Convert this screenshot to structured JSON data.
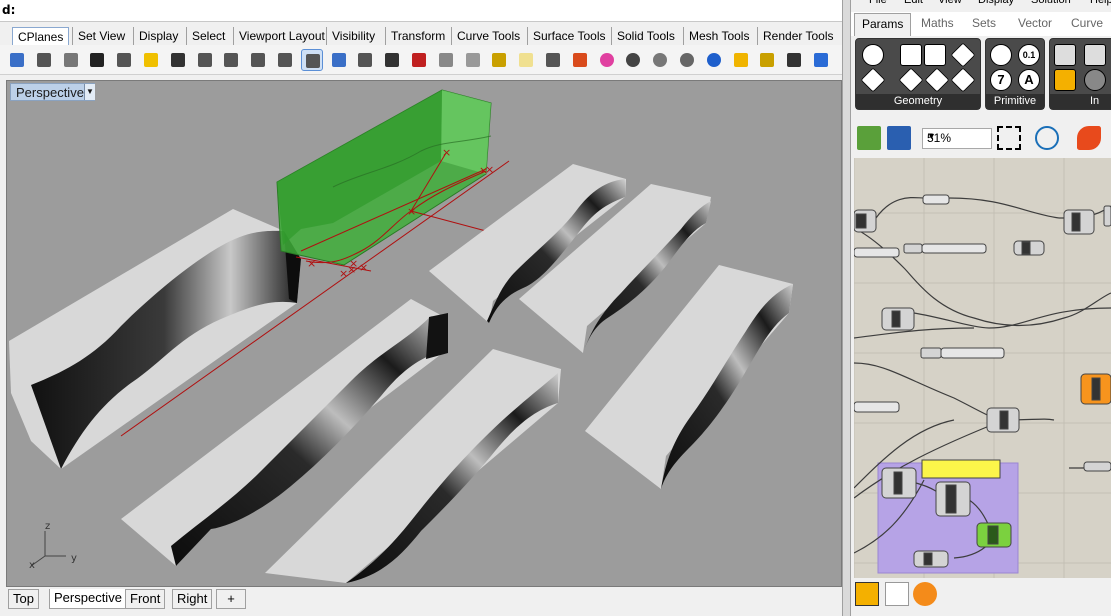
{
  "command": {
    "prompt": "d:"
  },
  "rhino_tabs": [
    "CPlanes",
    "Set View",
    "Display",
    "Select",
    "Viewport Layout",
    "Visibility",
    "Transform",
    "Curve Tools",
    "Surface Tools",
    "Solid Tools",
    "Mesh Tools",
    "Render Tools"
  ],
  "toolbar_icons": [
    "save-icon",
    "print-icon",
    "import-icon",
    "cut-icon",
    "copy-icon",
    "paste-icon",
    "undo-icon",
    "pan-hand-icon",
    "move-view-icon",
    "zoom-icon",
    "zoom-window-icon",
    "zoom-extents-icon",
    "zoom-selected-icon",
    "rotate-view-icon",
    "four-view-icon",
    "car-icon",
    "named-cplane-icon",
    "cplane-icon",
    "object-snap-icon",
    "light-bulb-icon",
    "lock-icon",
    "layer-icon",
    "color-wheel-icon",
    "shaded-sphere-icon",
    "rendered-sphere-icon",
    "render-sphere-icon",
    "blue-sphere-icon",
    "select-arrow-icon",
    "gear-icon",
    "dimension-icon",
    "help-icon"
  ],
  "viewport": {
    "name": "Perspective",
    "axes": {
      "z": "z",
      "y": "y",
      "x": "x"
    }
  },
  "view_tabs": [
    "Top",
    "Perspective",
    "Front",
    "Right"
  ],
  "add_view": "+",
  "grasshopper": {
    "menu": [
      "File",
      "Edit",
      "View",
      "Display",
      "Solution",
      "Help"
    ],
    "tabs": [
      "Params",
      "Maths",
      "Sets",
      "Vector",
      "Curve"
    ],
    "ribbon_groups": [
      "Geometry",
      "Primitive",
      "In"
    ],
    "primitive_glyphs": [
      "0",
      "0.1",
      "7",
      "A"
    ],
    "zoom": "51%",
    "colors": {
      "group_purple": "#b6a3e6",
      "panel_yellow": "#fcf54a",
      "toggle_green": "#7bd13f",
      "orange": "#f7941d"
    }
  }
}
